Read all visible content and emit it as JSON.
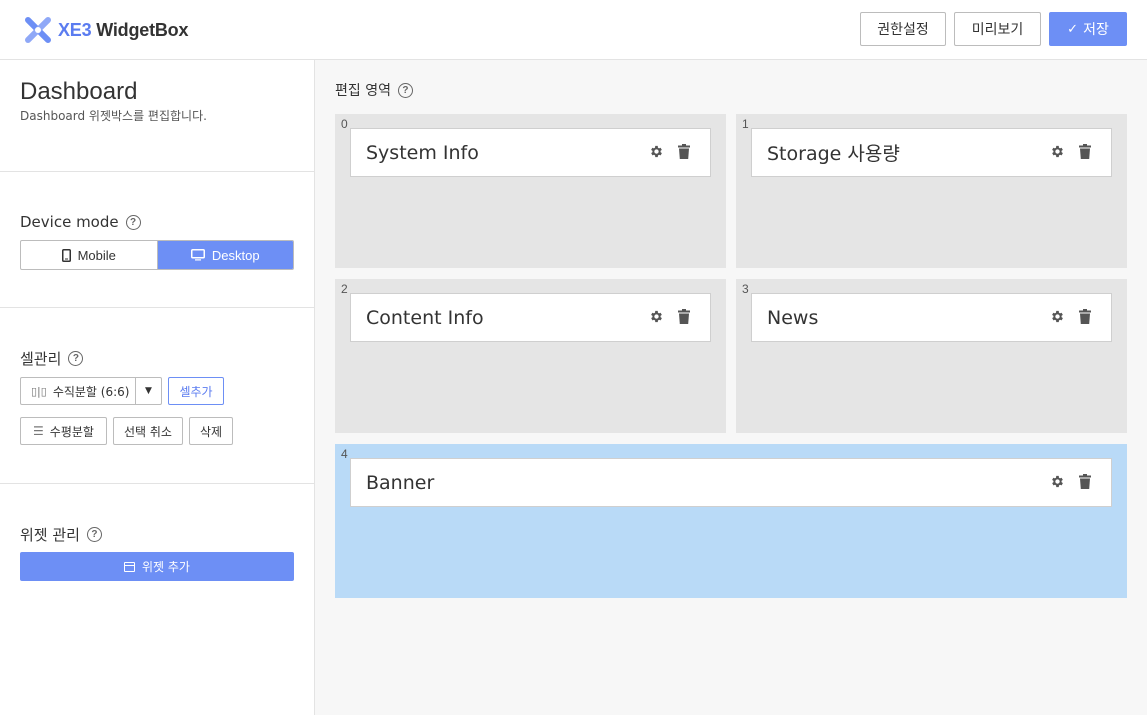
{
  "header": {
    "logo_prefix": "XE3",
    "logo_name": "WidgetBox",
    "permissions_label": "권한설정",
    "preview_label": "미리보기",
    "save_label": "저장"
  },
  "sidebar": {
    "title": "Dashboard",
    "subtitle": "Dashboard 위젯박스를 편집합니다.",
    "device_mode": {
      "label": "Device mode",
      "mobile_label": "Mobile",
      "desktop_label": "Desktop",
      "selected": "Desktop"
    },
    "cell_mgmt": {
      "label": "셀관리",
      "split_select_value": "수직분할 (6:6)",
      "add_cell_label": "셀추가",
      "horizontal_split_label": "수평분할",
      "deselect_label": "선택 취소",
      "delete_label": "삭제"
    },
    "widget_mgmt": {
      "label": "위젯 관리",
      "add_widget_label": "위젯 추가"
    }
  },
  "main": {
    "edit_area_label": "편집 영역",
    "cells": [
      {
        "index": "0",
        "widget": "System Info",
        "selected": false
      },
      {
        "index": "1",
        "widget": "Storage 사용량",
        "selected": false
      },
      {
        "index": "2",
        "widget": "Content Info",
        "selected": false
      },
      {
        "index": "3",
        "widget": "News",
        "selected": false
      },
      {
        "index": "4",
        "widget": "Banner",
        "selected": true
      }
    ]
  },
  "colors": {
    "accent": "#6d8ff5",
    "selected_cell": "#b9daf7",
    "cell_bg": "#e5e5e5"
  }
}
